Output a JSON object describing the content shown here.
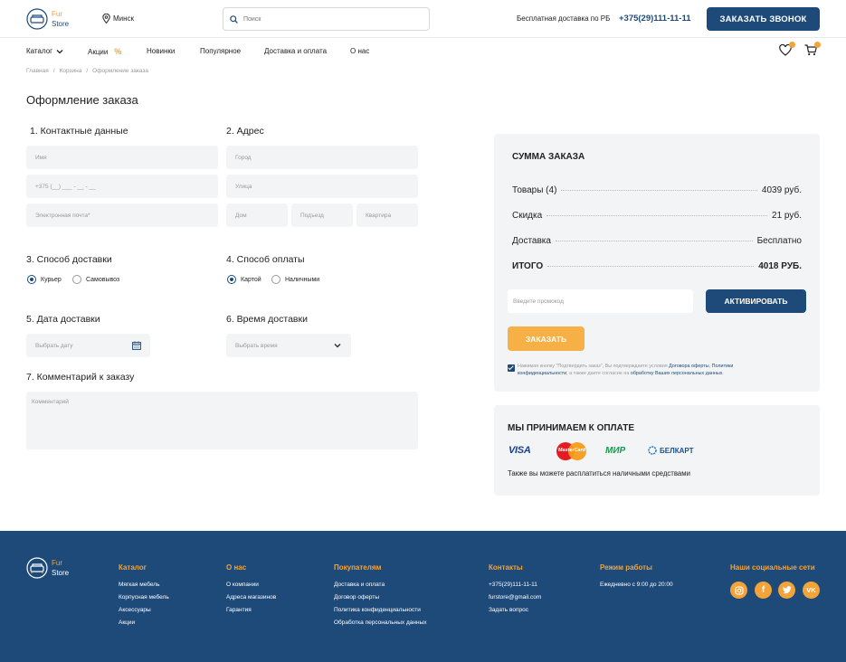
{
  "header": {
    "logo_line1": "Fur",
    "logo_line2": "Store",
    "city": "Минск",
    "search_placeholder": "Поиск",
    "shipping_note": "Бесплатная доставка по РБ",
    "phone": "+375(29)111-11-11",
    "callback_label": "ЗАКАЗАТЬ ЗВОНОК",
    "wishlist_count": "0",
    "cart_count": "0"
  },
  "nav": {
    "catalog": "Каталог",
    "sales": "Акции",
    "sales_badge": "%",
    "new": "Новинки",
    "popular": "Популярное",
    "delivery": "Доставка и оплата",
    "about": "О нас"
  },
  "breadcrumbs": [
    "Главная",
    "Корзина",
    "Оформление заказа"
  ],
  "page_title": "Оформление заказа",
  "form": {
    "contacts_title": "1. Контактные данные",
    "name_ph": "Имя",
    "phone_ph": "+375 (__) ___ - __ - __",
    "email_ph": "Электронная почта*",
    "address_title": "2. Адрес",
    "city_ph": "Город",
    "street_ph": "Улица",
    "house_ph": "Дом",
    "entrance_ph": "Подъезд",
    "flat_ph": "Квартира",
    "delivery_method_title": "3. Способ доставки",
    "courier": "Курьер",
    "pickup": "Самовывоз",
    "payment_method_title": "4. Способ оплаты",
    "card": "Картой",
    "cash": "Наличными",
    "delivery_date_title": "5. Дата доставки",
    "date_ph": "Выбрать дату",
    "delivery_time_title": "6. Время доставки",
    "time_ph": "Выбрать время",
    "comment_title": "7. Комментарий к заказу",
    "comment_ph": "Комментарий"
  },
  "summary": {
    "title": "СУММА ЗАКАЗА",
    "goods_label": "Товары (4)",
    "goods_value": "4039 руб.",
    "discount_label": "Скидка",
    "discount_value": "21 руб.",
    "shipping_label": "Доставка",
    "shipping_value": "Бесплатно",
    "total_label": "ИТОГО",
    "total_value": "4018 РУБ.",
    "promo_ph": "Введите промокод",
    "activate_label": "АКТИВИРОВАТЬ",
    "order_label": "ЗАКАЗАТЬ",
    "agree_text1": "Нажимая кнопку \"Подтвердить заказ\", Вы подтверждаете условия",
    "agree_link1": "Договора оферты",
    "agree_comma": ",",
    "agree_link2": "Политики конфиденциальности",
    "agree_text2": ", а также даете согласие на",
    "agree_link3": "обработку Ваших персональных данных",
    "agree_end": "."
  },
  "payment": {
    "title": "МЫ ПРИНИМАЕМ К ОПЛАТЕ",
    "visa": "VISA",
    "mastercard": "MasterCard",
    "mir": "МИР",
    "belkart": "БЕЛКАРТ",
    "cash_note": "Также вы можете расплатиться наличными средствами"
  },
  "footer": {
    "catalog_title": "Каталог",
    "catalog_items": [
      "Мягкая мебель",
      "Корпусная мебель",
      "Аксессуары",
      "Акции"
    ],
    "about_title": "О нас",
    "about_items": [
      "О компании",
      "Адреса магазинов",
      "Гарантия"
    ],
    "buyers_title": "Покупателям",
    "buyers_items": [
      "Доставка и оплата",
      "Договор оферты",
      "Политика конфиденциальности",
      "Обработка персональных данных"
    ],
    "contacts_title": "Контакты",
    "contacts_items": [
      "+375(29)111-11-11",
      "furstore@gmail.com",
      "Задать вопрос"
    ],
    "hours_title": "Режим работы",
    "hours_text": "Ежедневно с 9:00 до 20:00",
    "social_title": "Наши социальные сети",
    "social": {
      "facebook": "f",
      "vk": "VK"
    }
  },
  "colors": {
    "primary": "#1e4a7a",
    "accent": "#f2a33a",
    "field_bg": "#f3f4f5"
  },
  "icons": [
    "sofa-logo-icon",
    "location-pin-icon",
    "search-icon",
    "chevron-down-icon",
    "heart-icon",
    "cart-icon",
    "calendar-icon",
    "instagram-icon",
    "facebook-icon",
    "twitter-icon",
    "vk-icon"
  ]
}
